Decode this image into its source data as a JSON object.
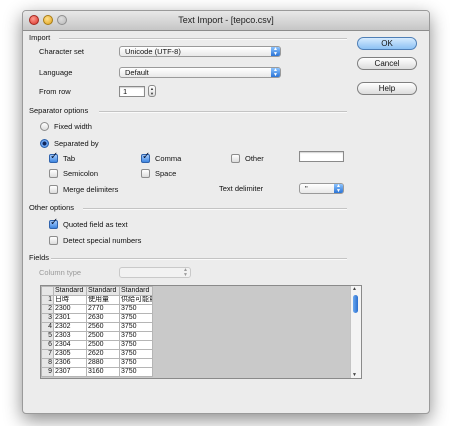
{
  "window": {
    "title": "Text Import - [tepco.csv]"
  },
  "import": {
    "section_label": "Import",
    "character_set_label": "Character set",
    "character_set_value": "Unicode (UTF-8)",
    "language_label": "Language",
    "language_value": "Default",
    "from_row_label": "From row",
    "from_row_value": "1"
  },
  "separator": {
    "section_label": "Separator options",
    "fixed_width_label": "Fixed width",
    "separated_by_label": "Separated by",
    "tab_label": "Tab",
    "comma_label": "Comma",
    "other_label": "Other",
    "semicolon_label": "Semicolon",
    "space_label": "Space",
    "merge_label": "Merge delimiters",
    "text_delimiter_label": "Text delimiter",
    "text_delimiter_value": "\"",
    "mode": "separated_by",
    "tab": true,
    "comma": true,
    "other": false,
    "semicolon": false,
    "space": false,
    "merge": false
  },
  "other": {
    "section_label": "Other options",
    "quoted_label": "Quoted field as text",
    "detect_label": "Detect special numbers",
    "quoted": true,
    "detect": false
  },
  "fields": {
    "section_label": "Fields",
    "column_type_label": "Column type",
    "column_type_value": "",
    "headers": [
      "Standard",
      "Standard",
      "Standard"
    ],
    "rows": [
      {
        "n": "1",
        "cells": [
          "日時",
          "使用量",
          "供給可能量"
        ]
      },
      {
        "n": "2",
        "cells": [
          "2300",
          "2770",
          "3750"
        ]
      },
      {
        "n": "3",
        "cells": [
          "2301",
          "2630",
          "3750"
        ]
      },
      {
        "n": "4",
        "cells": [
          "2302",
          "2560",
          "3750"
        ]
      },
      {
        "n": "5",
        "cells": [
          "2303",
          "2500",
          "3750"
        ]
      },
      {
        "n": "6",
        "cells": [
          "2304",
          "2500",
          "3750"
        ]
      },
      {
        "n": "7",
        "cells": [
          "2305",
          "2620",
          "3750"
        ]
      },
      {
        "n": "8",
        "cells": [
          "2306",
          "2880",
          "3750"
        ]
      },
      {
        "n": "9",
        "cells": [
          "2307",
          "3160",
          "3750"
        ]
      }
    ]
  },
  "buttons": {
    "ok": "OK",
    "cancel": "Cancel",
    "help": "Help"
  },
  "colors": {
    "accent": "#3f86e0",
    "window_bg": "#ececec"
  }
}
